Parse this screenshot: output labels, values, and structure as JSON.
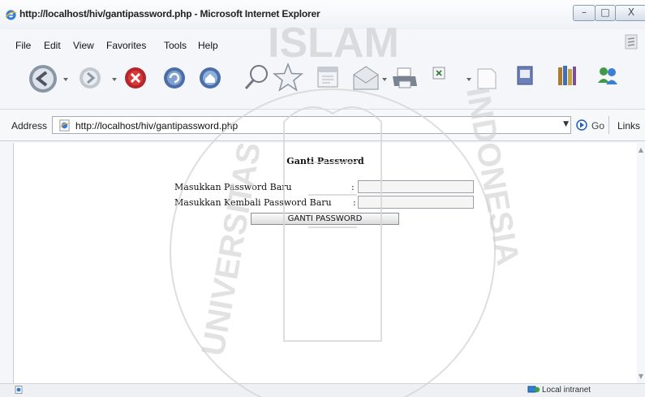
{
  "window": {
    "title": "http://localhost/hiv/gantipassword.php - Microsoft Internet Explorer",
    "controls": {
      "minimize": "–",
      "maximize": "□",
      "close": "X"
    }
  },
  "menu": [
    "File",
    "Edit",
    "View",
    "Favorites",
    "Tools",
    "Help"
  ],
  "toolbar": {
    "icons": [
      "back-icon",
      "forward-icon",
      "stop-icon",
      "refresh-icon",
      "home-icon",
      "search-icon",
      "favorites-star-icon",
      "history-icon",
      "mail-icon",
      "print-icon",
      "edit-icon",
      "blank-page-icon",
      "messenger-icon",
      "research-icon",
      "contacts-icon"
    ]
  },
  "address_bar": {
    "label": "Address",
    "url": "http://localhost/hiv/gantipassword.php",
    "go_label": "Go",
    "links_label": "Links"
  },
  "page": {
    "title": "Ganti Password",
    "fields": [
      {
        "label": "Masukkan Password Baru",
        "colon": ":",
        "value": ""
      },
      {
        "label": "Masukkan Kembali Password Baru",
        "colon": ":",
        "value": ""
      }
    ],
    "submit_label": "GANTI PASSWORD"
  },
  "status_bar": {
    "zone": "Local intranet"
  },
  "watermark": {
    "top_text": "ISLAM",
    "left_text": "UNIVERSITAS",
    "right_text": "INDONESIA"
  },
  "colors": {
    "accent_blue": "#1d5fb8",
    "titlebar_bg": "#eef2f7",
    "watermark": "#cfcfcf"
  }
}
